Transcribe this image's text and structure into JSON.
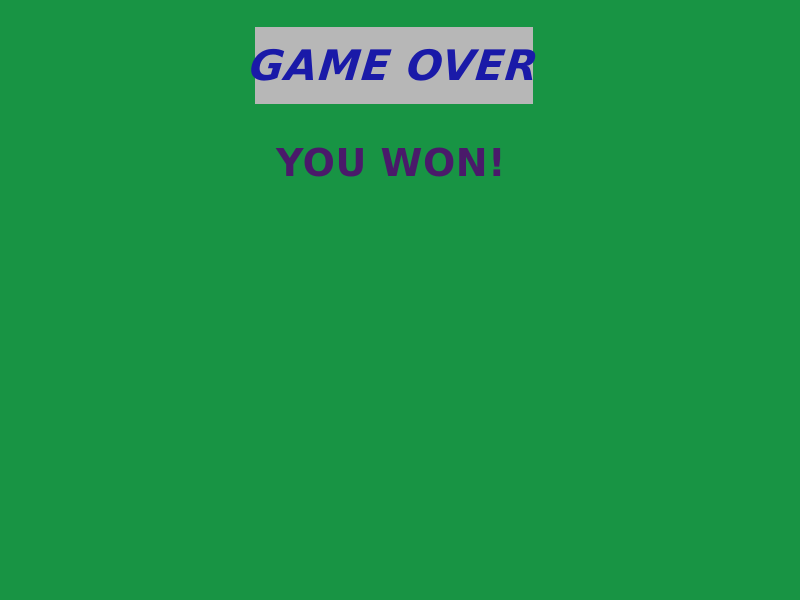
{
  "screen": {
    "title": "GAME OVER",
    "result": "YOU WON!"
  },
  "colors": {
    "background": "#189444",
    "title_panel": "#b7b7b7",
    "title_text": "#1a1aa8",
    "result_text": "#4a1a6a"
  }
}
